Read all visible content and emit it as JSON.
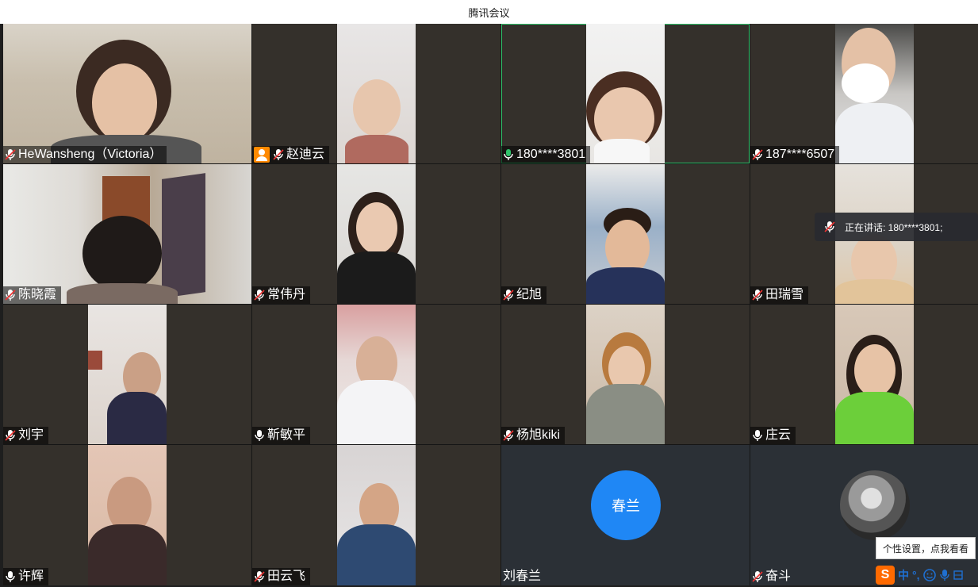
{
  "window": {
    "title": "腾讯会议"
  },
  "participants": [
    {
      "name": "HeWansheng（Victoria）",
      "mic": "muted",
      "host": false
    },
    {
      "name": "赵迪云",
      "mic": "muted",
      "host": true
    },
    {
      "name": "180****3801",
      "mic": "active",
      "host": false,
      "speaking": true
    },
    {
      "name": "187****6507",
      "mic": "muted",
      "host": false
    },
    {
      "name": "陈晓霞",
      "mic": "muted",
      "host": false
    },
    {
      "name": "常伟丹",
      "mic": "muted",
      "host": false
    },
    {
      "name": "纪旭",
      "mic": "muted",
      "host": false
    },
    {
      "name": "田瑞雪",
      "mic": "muted",
      "host": false
    },
    {
      "name": "刘宇",
      "mic": "muted",
      "host": false
    },
    {
      "name": "靳敏平",
      "mic": "on",
      "host": false
    },
    {
      "name": "杨旭kiki",
      "mic": "muted",
      "host": false
    },
    {
      "name": "庄云",
      "mic": "on",
      "host": false
    },
    {
      "name": "许辉",
      "mic": "on",
      "host": false
    },
    {
      "name": "田云飞",
      "mic": "muted",
      "host": false
    },
    {
      "name": "刘春兰",
      "mic": "none",
      "host": false,
      "avatar_text": "春兰"
    },
    {
      "name": "奋斗",
      "mic": "muted",
      "host": false
    }
  ],
  "speaking_indicator": {
    "text": "正在讲话: 180****3801;"
  },
  "ime": {
    "tooltip": "个性设置，点我看看",
    "logo": "S",
    "mode": "中",
    "punct": "°,",
    "emoji_icon": "smile-icon",
    "voice_icon": "mic-icon",
    "keyboard_icon": "keyboard-icon"
  },
  "colors": {
    "active_outline": "#2fc36b",
    "avatar_blue": "#1f87f5",
    "ime_orange": "#ff6a00"
  }
}
